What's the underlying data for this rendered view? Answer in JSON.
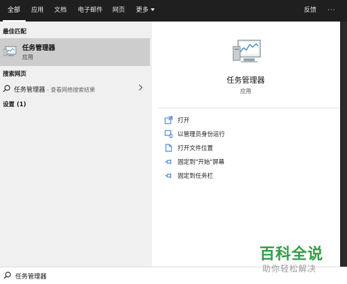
{
  "tabs": [
    {
      "label": "全部",
      "active": true
    },
    {
      "label": "应用"
    },
    {
      "label": "文档"
    },
    {
      "label": "电子邮件"
    },
    {
      "label": "网页"
    },
    {
      "label": "更多"
    }
  ],
  "topbar": {
    "feedback": "反馈",
    "more_menu": "···"
  },
  "left": {
    "best_match_heading": "最佳匹配",
    "best_match": {
      "title": "任务管理器",
      "subtitle": "应用",
      "icon": "task-manager-icon"
    },
    "web_heading": "搜索网页",
    "web_item": {
      "query": "任务管理器",
      "hint": " - 查看网络搜索结果"
    },
    "settings_heading": "设置 (1)"
  },
  "preview": {
    "title": "任务管理器",
    "subtitle": "应用",
    "actions": [
      {
        "label": "打开",
        "icon": "open-icon"
      },
      {
        "label": "以管理员身份运行",
        "icon": "run-as-admin-icon"
      },
      {
        "label": "打开文件位置",
        "icon": "file-location-icon"
      },
      {
        "label": "固定到\"开始\"屏幕",
        "icon": "pin-start-icon"
      },
      {
        "label": "固定到任务栏",
        "icon": "pin-taskbar-icon"
      }
    ]
  },
  "search": {
    "value": "任务管理器"
  },
  "watermark": {
    "main": "百科全说",
    "sub": "助你轻松解决"
  },
  "colors": {
    "topbar": "#1f1f1f",
    "selected": "#cdcdcd",
    "accent": "#2b6fd6",
    "watermark": "#2f9e44"
  }
}
